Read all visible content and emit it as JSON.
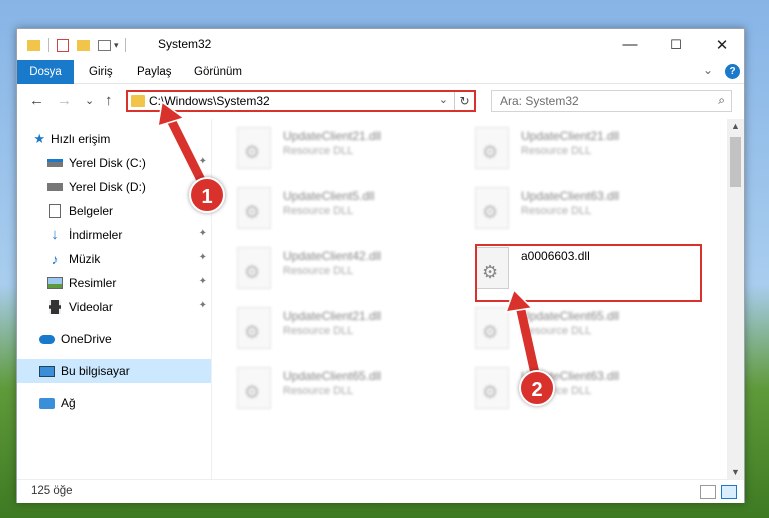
{
  "window": {
    "title": "System32",
    "minimize": "—",
    "maximize": "☐",
    "close": "✕"
  },
  "ribbon": {
    "tabs": [
      "Dosya",
      "Giriş",
      "Paylaş",
      "Görünüm"
    ],
    "collapse": "⌄",
    "help": "?"
  },
  "nav": {
    "back": "←",
    "forward": "→",
    "recent": "⌄",
    "up": "↑",
    "address": "C:\\Windows\\System32",
    "address_dropdown": "⌄",
    "refresh": "↻",
    "search_placeholder": "Ara: System32",
    "search_icon": "⌕"
  },
  "sidebar": {
    "items": [
      {
        "label": "Hızlı erişim",
        "icon": "star-icon",
        "pinned": false
      },
      {
        "label": "Yerel Disk (C:)",
        "icon": "drive-icon",
        "pinned": true
      },
      {
        "label": "Yerel Disk (D:)",
        "icon": "drive-icon",
        "pinned": true
      },
      {
        "label": "Belgeler",
        "icon": "documents-icon",
        "pinned": true
      },
      {
        "label": "İndirmeler",
        "icon": "download-icon",
        "pinned": true
      },
      {
        "label": "Müzik",
        "icon": "music-icon",
        "pinned": true
      },
      {
        "label": "Resimler",
        "icon": "pictures-icon",
        "pinned": true
      },
      {
        "label": "Videolar",
        "icon": "videos-icon",
        "pinned": true
      },
      {
        "label": "OneDrive",
        "icon": "cloud-icon",
        "pinned": false
      },
      {
        "label": "Bu bilgisayar",
        "icon": "computer-icon",
        "pinned": false,
        "selected": true
      },
      {
        "label": "Ağ",
        "icon": "network-icon",
        "pinned": false
      }
    ],
    "pin_glyph": "📌"
  },
  "files": [
    {
      "name": "UpdateClient21.dll",
      "desc": "Resource DLL"
    },
    {
      "name": "UpdateClient21.dll",
      "desc": "Resource DLL"
    },
    {
      "name": "UpdateClient5.dll",
      "desc": "Resource DLL"
    },
    {
      "name": "UpdateClient63.dll",
      "desc": "Resource DLL"
    },
    {
      "name": "UpdateClient42.dll",
      "desc": "Resource DLL"
    },
    {
      "name": "a0006603.dll",
      "desc": ""
    },
    {
      "name": "UpdateClient21.dll",
      "desc": "Resource DLL"
    },
    {
      "name": "UpdateClient65.dll",
      "desc": "Resource DLL"
    },
    {
      "name": "UpdateClient65.dll",
      "desc": "Resource DLL"
    },
    {
      "name": "UpdateClient63.dll",
      "desc": "Resource DLL"
    }
  ],
  "status": {
    "count": "125 öğe"
  },
  "annotations": {
    "step1": "1",
    "step2": "2",
    "color": "#d9322c"
  },
  "colors": {
    "accent": "#1979ca",
    "selection": "#cce8ff",
    "highlight": "#d9322c"
  }
}
